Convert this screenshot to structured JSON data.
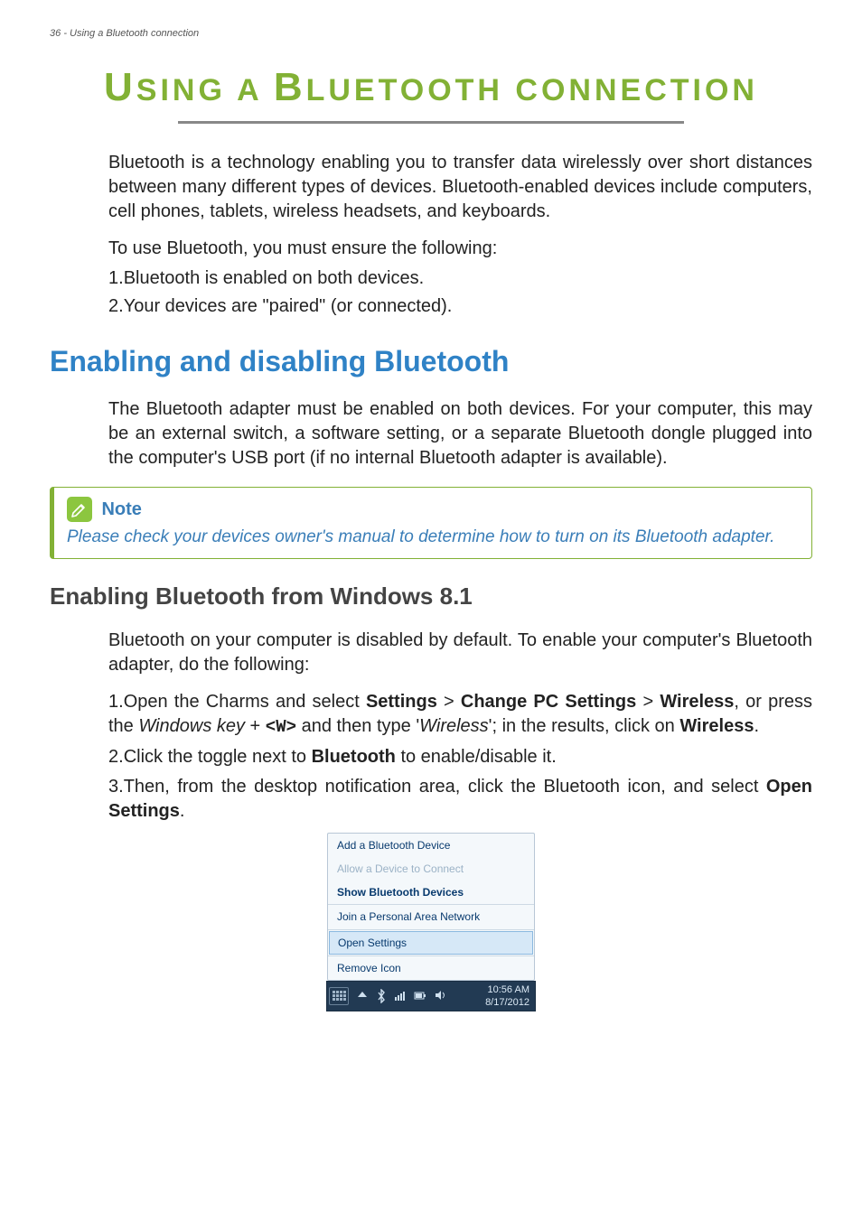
{
  "header": {
    "page_no": "36",
    "running": "Using a Bluetooth connection"
  },
  "title_first": "U",
  "title_rest1": "SING A ",
  "title_big2": "B",
  "title_rest2": "LUETOOTH CONNECTION",
  "intro": "Bluetooth is a technology enabling you to transfer data wirelessly over short distances between many different types of devices. Bluetooth-enabled devices include computers, cell phones, tablets, wireless headsets, and keyboards.",
  "use_intro": "To use Bluetooth, you must ensure the following:",
  "use_list": [
    {
      "n": "1.",
      "t": "Bluetooth is enabled on both devices."
    },
    {
      "n": "2.",
      "t": "Your devices are \"paired\" (or connected)."
    }
  ],
  "h2": "Enabling and disabling Bluetooth",
  "h2_body": "The Bluetooth adapter must be enabled on both devices. For your computer, this may be an external switch, a software setting, or a separate Bluetooth dongle plugged into the computer's USB port (if no internal Bluetooth adapter is available).",
  "note": {
    "title": "Note",
    "body": "Please check your devices owner's manual to determine how to turn on its Bluetooth adapter."
  },
  "h3": "Enabling Bluetooth from Windows 8.1",
  "h3_intro": "Bluetooth on your computer is disabled by default. To enable your computer's Bluetooth adapter, do the following:",
  "steps": {
    "s1": {
      "n": "1.",
      "pre": "Open the Charms and select ",
      "b1": "Settings",
      "sep1": " > ",
      "b2": "Change PC Settings",
      "sep2": " > ",
      "b3": "Wireless",
      "mid1": ", or press the ",
      "i1": "Windows key",
      "plus": " + ",
      "mono": "<W>",
      "mid2": " and then type '",
      "i2": "Wireless",
      "mid3": "'; in the results, click on ",
      "b4": "Wireless",
      "end": "."
    },
    "s2": {
      "n": "2.",
      "pre": "Click the toggle next to ",
      "b1": "Bluetooth",
      "end": " to enable/disable it."
    },
    "s3": {
      "n": "3.",
      "pre": "Then, from the desktop notification area, click the Bluetooth icon, and select ",
      "b1": "Open Settings",
      "end": "."
    }
  },
  "menu": {
    "m1": "Add a Bluetooth Device",
    "m2": "Allow a Device to Connect",
    "m3": "Show Bluetooth Devices",
    "m4": "Join a Personal Area Network",
    "m5": "Open Settings",
    "m6": "Remove Icon"
  },
  "clock": {
    "time": "10:56 AM",
    "date": "8/17/2012"
  }
}
